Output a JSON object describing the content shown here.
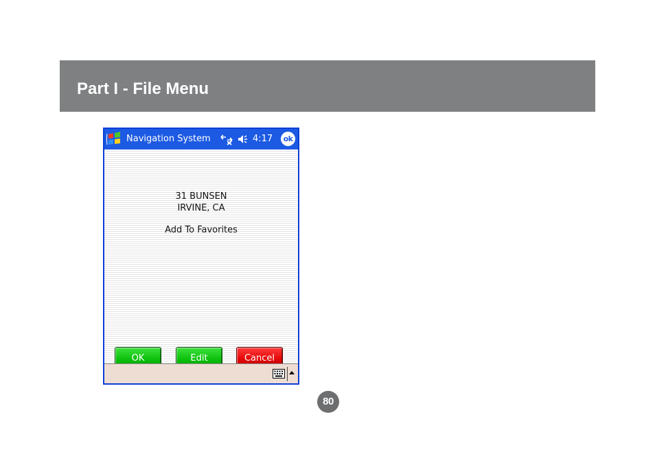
{
  "page": {
    "section_title": "Part I - File Menu",
    "page_number": "80",
    "header_color": "#7e8082"
  },
  "device": {
    "titlebar": {
      "start_icon": "windows-flag-icon",
      "app_title": "Navigation System",
      "connectivity_icon": "connectivity-icon",
      "volume_icon": "speaker-icon",
      "clock": "4:17",
      "ok_label": "ok",
      "bar_color": "#1c5ae3"
    },
    "content": {
      "address_line1": "31 BUNSEN",
      "address_line2": "IRVINE, CA",
      "action_label": "Add To Favorites"
    },
    "buttons": {
      "ok": "OK",
      "edit": "Edit",
      "cancel": "Cancel",
      "green": "#0cc20c",
      "red": "#e60808"
    },
    "bottombar": {
      "keyboard_icon": "keyboard-icon",
      "arrow_icon": "triangle-up-icon"
    }
  }
}
